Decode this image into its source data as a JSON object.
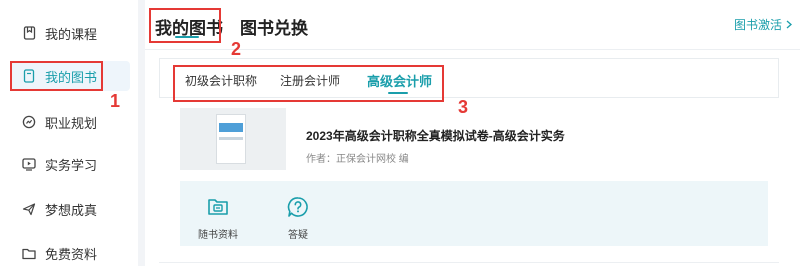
{
  "sidebar": {
    "items": [
      {
        "label": "我的课程",
        "icon": "bookmark-icon"
      },
      {
        "label": "我的图书",
        "icon": "book-icon"
      },
      {
        "label": "职业规划",
        "icon": "compass-icon"
      },
      {
        "label": "实务学习",
        "icon": "play-screen-icon"
      },
      {
        "label": "梦想成真",
        "icon": "send-icon"
      },
      {
        "label": "免费资料",
        "icon": "folder-icon"
      }
    ]
  },
  "header": {
    "tabs": [
      {
        "label": "我的图书"
      },
      {
        "label": "图书兑换"
      }
    ],
    "activate_link": "图书激活"
  },
  "subtabs": [
    {
      "label": "初级会计职称"
    },
    {
      "label": "注册会计师"
    },
    {
      "label": "高级会计师"
    }
  ],
  "book": {
    "title": "2023年高级会计职称全真模拟试卷-高级会计实务",
    "author": "作者：正保会计网校 编"
  },
  "actions": [
    {
      "label": "随书资料",
      "icon": "book-materials-icon"
    },
    {
      "label": "答疑",
      "icon": "question-icon"
    }
  ],
  "annotations": [
    "1",
    "2",
    "3"
  ],
  "colors": {
    "accent": "#1a9eab",
    "annotation": "#e53935"
  }
}
